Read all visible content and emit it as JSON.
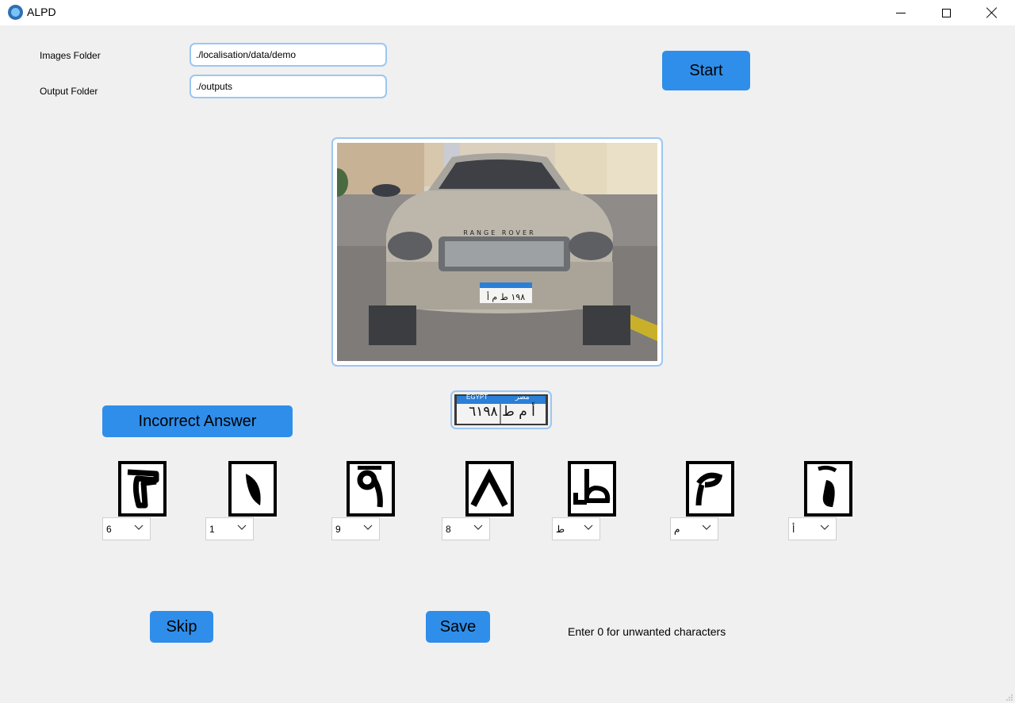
{
  "window": {
    "title": "ALPD",
    "controls": {
      "minimize": "minimize-icon",
      "maximize": "maximize-icon",
      "close": "close-icon"
    }
  },
  "form": {
    "images_folder_label": "Images Folder",
    "images_folder_value": "./localisation/data/demo",
    "output_folder_label": "Output Folder",
    "output_folder_value": "./outputs"
  },
  "buttons": {
    "start": "Start",
    "incorrect_answer": "Incorrect Answer",
    "skip": "Skip",
    "save": "Save"
  },
  "plate": {
    "country_text": "EGYPT",
    "country_text_ar": "مصر",
    "plate_text": "أ م ط ٦١٩٨"
  },
  "characters": [
    {
      "glyph": "٦",
      "selected": "6"
    },
    {
      "glyph": "١",
      "selected": "1"
    },
    {
      "glyph": "٩",
      "selected": "9"
    },
    {
      "glyph": "٨",
      "selected": "8"
    },
    {
      "glyph": "ط",
      "selected": "ط"
    },
    {
      "glyph": "م",
      "selected": "م"
    },
    {
      "glyph": "أ",
      "selected": "أ"
    }
  ],
  "hint": "Enter 0 for unwanted characters",
  "colors": {
    "accent": "#2f8ee9",
    "input_border": "#9cc6f3",
    "background": "#f0f0f0"
  }
}
